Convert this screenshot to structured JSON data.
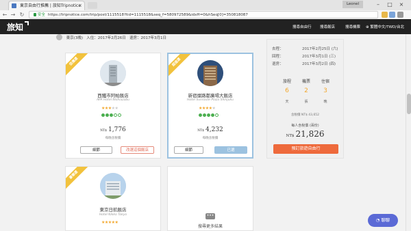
{
  "browser": {
    "tab_title": "東京自由行推薦 | 旅知Tripnotice",
    "user_label": "Leonel",
    "secure_label": "安全",
    "url": "https://tripnotice.com/trip/post/1115518?tid=1115518&seq_f=580972589&idxH=0&hSeq[0]=350818087"
  },
  "site": {
    "logo": "旅知",
    "nav": [
      "搜尋自由行",
      "搜尋飯店",
      "搜尋機票",
      "繁體中文/TWD/台北"
    ]
  },
  "trip_strip": {
    "destination": "東京(3晚)",
    "checkin": "入住：2017年2月26日",
    "checkout": "退房：2017年3月1日"
  },
  "hotels": [
    {
      "ribbon": "低價選",
      "name": "西鐵市阿帕飯店",
      "name_en": "APA Hotel Nishiazabu",
      "stars": 3,
      "rating": 3,
      "currency": "NT$",
      "price": "1,776",
      "price_note": "每晚含稅價",
      "detail_label": "細節",
      "action_label": "改選這個飯店"
    },
    {
      "ribbon": "超值選",
      "name": "新宿燦路都廣場大飯店",
      "name_en": "Hotel Sunroute Plaza Shinjuku",
      "stars": 4,
      "rating": 4,
      "currency": "NT$",
      "price": "4,232",
      "price_note": "每晚含稅價",
      "detail_label": "細節",
      "action_label": "已選"
    },
    {
      "ribbon": "豪華選",
      "name": "東京日航飯店",
      "name_en": "Hotel Nikko Tokyo",
      "stars": 5
    }
  ],
  "more_results": {
    "icon": "more-icon",
    "label": "搜尋更多結果"
  },
  "summary": {
    "rows": [
      {
        "label": "去程：",
        "value": "2017年2月25日 (六)"
      },
      {
        "label": "回程：",
        "value": "2017年3月1日 (三)"
      },
      {
        "label": "退房：",
        "value": "2017年3月2日 (四)"
      }
    ],
    "stats": [
      {
        "title": "旅程",
        "value": "6",
        "unit": "天"
      },
      {
        "title": "機票",
        "value": "2",
        "unit": "張"
      },
      {
        "title": "住宿",
        "value": "3",
        "unit": "晚"
      }
    ],
    "price_note": "含稅價 NT$ 43,652",
    "total_label": "每人含稅價 (兩份)",
    "total_currency": "NT$",
    "total": "21,826",
    "book_label": "預訂旅遊自由行"
  },
  "chat": {
    "label": "聊聊"
  }
}
